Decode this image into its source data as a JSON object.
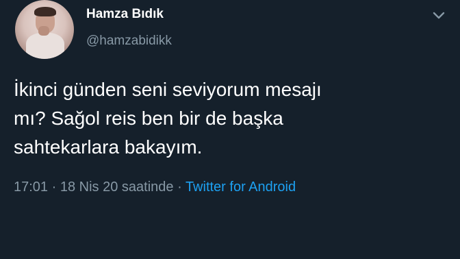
{
  "tweet": {
    "display_name": "Hamza Bıdık",
    "handle": "@hamzabidikk",
    "menu_icon": "chevron-down-icon",
    "text": "İkinci günden seni seviyorum mesajı\nmı? Sağol reis ben bir de başka\nsahtekarlara bakayım.",
    "time": "17:01",
    "separator": " · ",
    "date": "18 Nis 20 saatinde",
    "source": "Twitter for Android"
  },
  "colors": {
    "background": "#15202b",
    "text": "#ffffff",
    "muted": "#8899a6",
    "link": "#1da1f2"
  }
}
